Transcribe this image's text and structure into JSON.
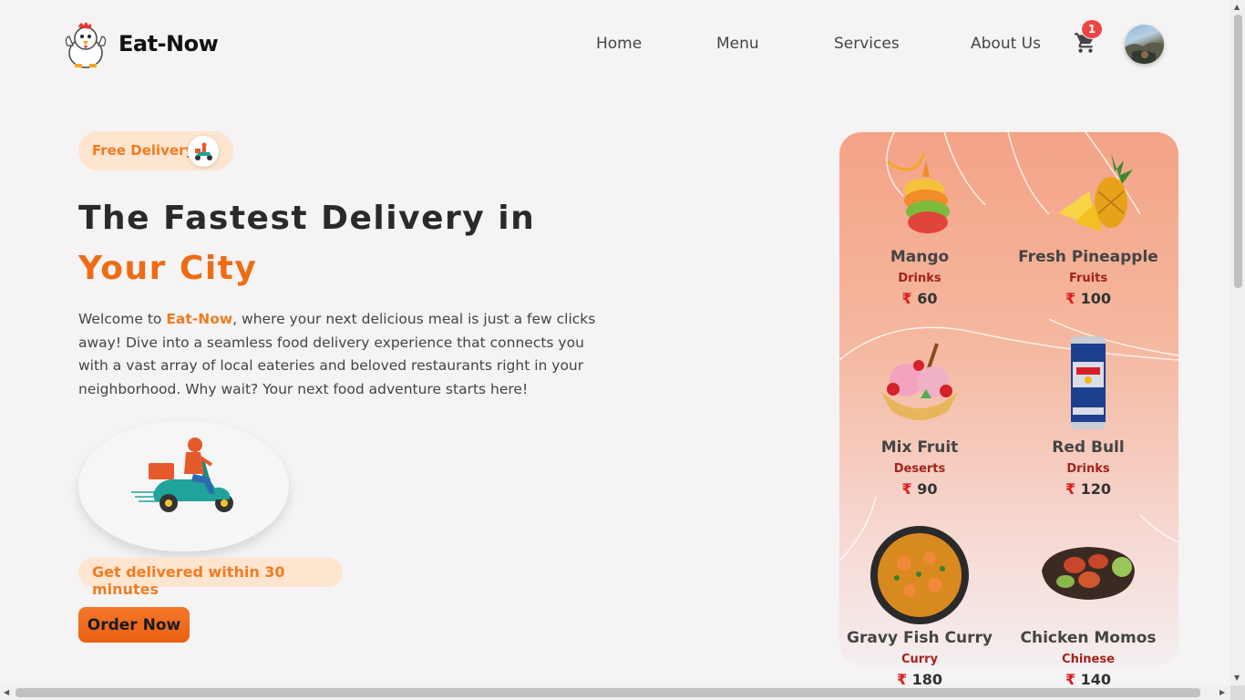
{
  "header": {
    "brand": "Eat-Now",
    "nav": [
      "Home",
      "Menu",
      "Services",
      "About Us"
    ],
    "cart_count": "1"
  },
  "hero": {
    "badge": "Free Delivery",
    "headline_part1": "The Fastest Delivery in ",
    "headline_accent": "Your City",
    "intro_prefix": "Welcome to ",
    "intro_brand": "Eat-Now",
    "intro_suffix": ", where your next delicious meal is just a few clicks away! Dive into a seamless food delivery experience that connects you with a vast array of local eateries and beloved restaurants right in your neighborhood. Why wait? Your next food adventure starts here!",
    "delivery_time": "Get delivered within 30 minutes",
    "order_button": "Order Now"
  },
  "menu_items": [
    {
      "name": "Mango",
      "category": "Drinks",
      "currency": "₹",
      "price": "60"
    },
    {
      "name": "Fresh Pineapple",
      "category": "Fruits",
      "currency": "₹",
      "price": "100"
    },
    {
      "name": "Mix Fruit",
      "category": "Deserts",
      "currency": "₹",
      "price": "90"
    },
    {
      "name": "Red Bull",
      "category": "Drinks",
      "currency": "₹",
      "price": "120"
    },
    {
      "name": "Gravy Fish Curry",
      "category": "Curry",
      "currency": "₹",
      "price": "180"
    },
    {
      "name": "Chicken Momos",
      "category": "Chinese",
      "currency": "₹",
      "price": "140"
    }
  ],
  "colors": {
    "accent": "#ef6c14",
    "badge_bg": "#fde5d0",
    "cart_badge": "#ef4444",
    "category_text": "#a3231a"
  },
  "icons": [
    "chicken-mascot-logo",
    "cart-icon",
    "scooter-icon",
    "rupee-icon"
  ]
}
